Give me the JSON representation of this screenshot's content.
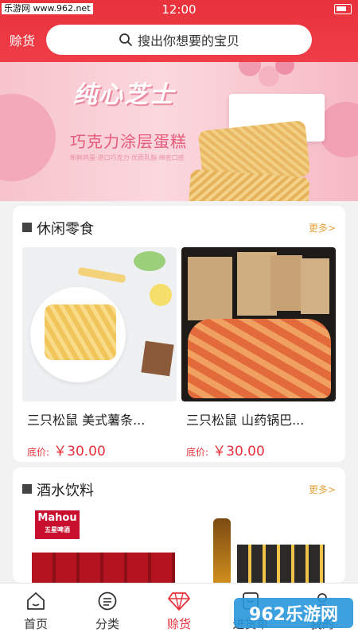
{
  "status": {
    "time": "12:00",
    "watermark": "乐游网 www.962.net"
  },
  "header": {
    "city": "赊货",
    "search_placeholder": "搜出你想要的宝贝"
  },
  "banner": {
    "title": "纯心芝士",
    "subtitle": "巧克力涂层蛋糕",
    "tag": "新鲜鸡蛋·进口巧克力·优质乳脂·绵密口感"
  },
  "sections": [
    {
      "title": "休闲零食",
      "more": "更多>",
      "products": [
        {
          "name": "三只松鼠 美式薯条...",
          "price_label": "底价:",
          "price": "￥30.00"
        },
        {
          "name": "三只松鼠 山药锅巴...",
          "price_label": "底价:",
          "price": "￥30.00"
        }
      ]
    },
    {
      "title": "酒水饮料",
      "more": "更多>",
      "products": [
        {
          "name": "",
          "brand": "Mahou",
          "brand_sub": "五星啤酒"
        },
        {
          "name": ""
        }
      ]
    }
  ],
  "tabs": [
    {
      "label": "首页",
      "icon": "home-icon"
    },
    {
      "label": "分类",
      "icon": "category-icon"
    },
    {
      "label": "赊货",
      "icon": "diamond-icon",
      "active": true
    },
    {
      "label": "进货单",
      "icon": "cart-icon"
    },
    {
      "label": "我的",
      "icon": "user-icon"
    }
  ],
  "watermark_bottom": "962乐游网",
  "colors": {
    "primary": "#e8323c",
    "more": "#e6a23c"
  }
}
